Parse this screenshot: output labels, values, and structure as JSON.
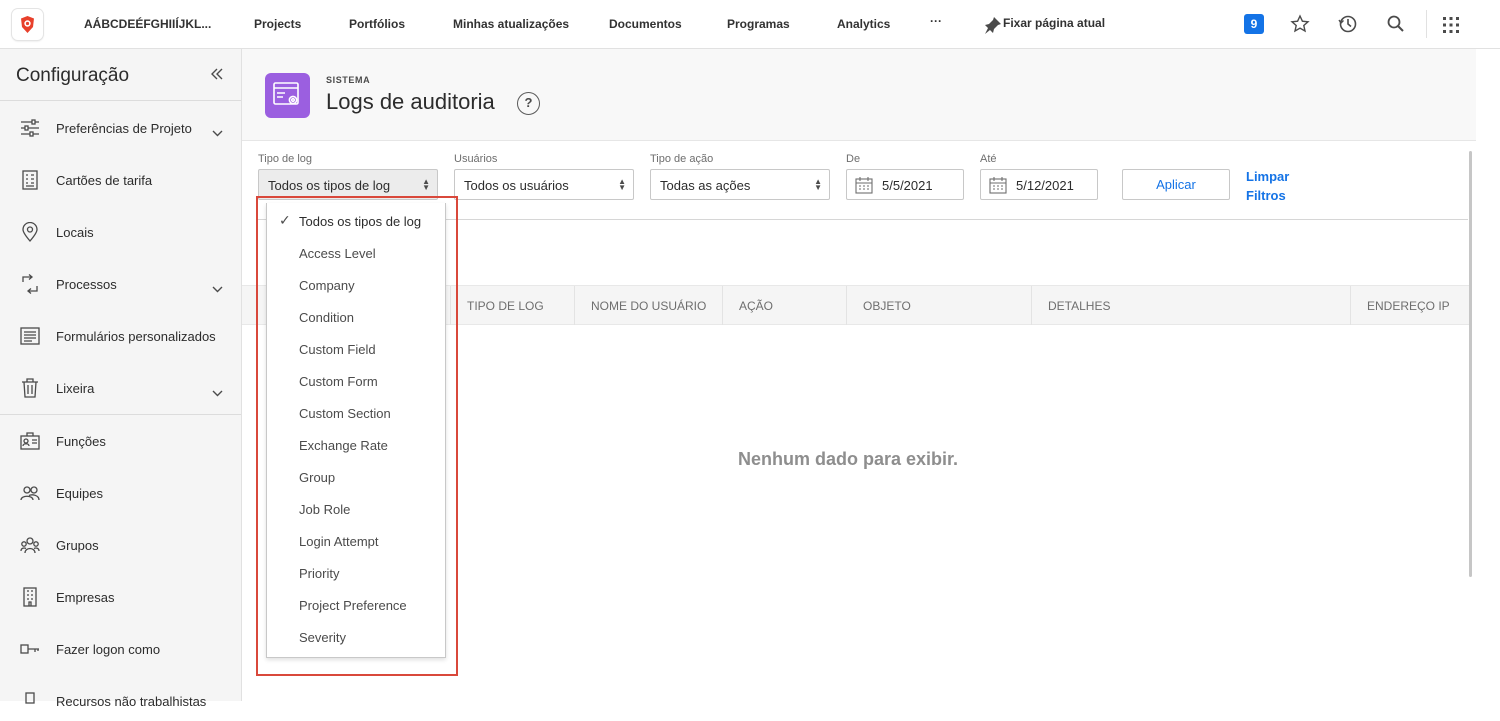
{
  "topbar": {
    "org_name": "AÁBCDEÉFGHIIÍJKL...",
    "nav": [
      "Projects",
      "Portfólios",
      "Minhas atualizações",
      "Documentos",
      "Programas",
      "Analytics"
    ],
    "more": "···",
    "pin_label": "Fixar página atual",
    "notification_count": "9",
    "accent": "#1473e6"
  },
  "sidebar": {
    "title": "Configuração",
    "collapse_icon": "double-chevron-left-icon",
    "items": [
      {
        "label": "Preferências de Projeto",
        "icon": "sliders-icon",
        "has_children": true
      },
      {
        "label": "Cartões de tarifa",
        "icon": "rate-card-icon",
        "has_children": false
      },
      {
        "label": "Locais",
        "icon": "location-pin-icon",
        "has_children": false
      },
      {
        "label": "Processos",
        "icon": "process-cycle-icon",
        "has_children": true
      },
      {
        "label": "Formulários personalizados",
        "icon": "custom-form-icon",
        "has_children": false
      },
      {
        "label": "Lixeira",
        "icon": "trash-icon",
        "has_children": true
      },
      {
        "label": "Funções",
        "icon": "job-role-icon",
        "has_children": false
      },
      {
        "label": "Equipes",
        "icon": "teams-icon",
        "has_children": false
      },
      {
        "label": "Grupos",
        "icon": "groups-icon",
        "has_children": false
      },
      {
        "label": "Empresas",
        "icon": "building-icon",
        "has_children": false
      },
      {
        "label": "Fazer logon como",
        "icon": "key-icon",
        "has_children": false
      },
      {
        "label": "Recursos não trabalhistas",
        "icon": "resource-icon",
        "has_children": false
      }
    ]
  },
  "header": {
    "eyebrow": "SISTEMA",
    "title": "Logs de auditoria",
    "help": "?",
    "icon_color": "#9b5fe0"
  },
  "filters": {
    "log_type": {
      "label": "Tipo de log",
      "value": "Todos os tipos de log"
    },
    "users": {
      "label": "Usuários",
      "value": "Todos os usuários"
    },
    "action_type": {
      "label": "Tipo de ação",
      "value": "Todas as ações"
    },
    "from": {
      "label": "De",
      "value": "5/5/2021"
    },
    "to": {
      "label": "Até",
      "value": "5/12/2021"
    },
    "apply_label": "Aplicar",
    "clear_label": "Limpar Filtros"
  },
  "table": {
    "columns": [
      "TIPO DE LOG",
      "NOME DO USUÁRIO",
      "AÇÃO",
      "OBJETO",
      "DETALHES",
      "ENDEREÇO IP"
    ],
    "empty_message": "Nenhum dado para exibir."
  },
  "log_type_dropdown": {
    "selected_index": 0,
    "options": [
      "Todos os tipos de log",
      "Access Level",
      "Company",
      "Condition",
      "Custom Field",
      "Custom Form",
      "Custom Section",
      "Exchange Rate",
      "Group",
      "Job Role",
      "Login Attempt",
      "Priority",
      "Project Preference",
      "Severity"
    ],
    "highlight_color": "#d9483b"
  }
}
